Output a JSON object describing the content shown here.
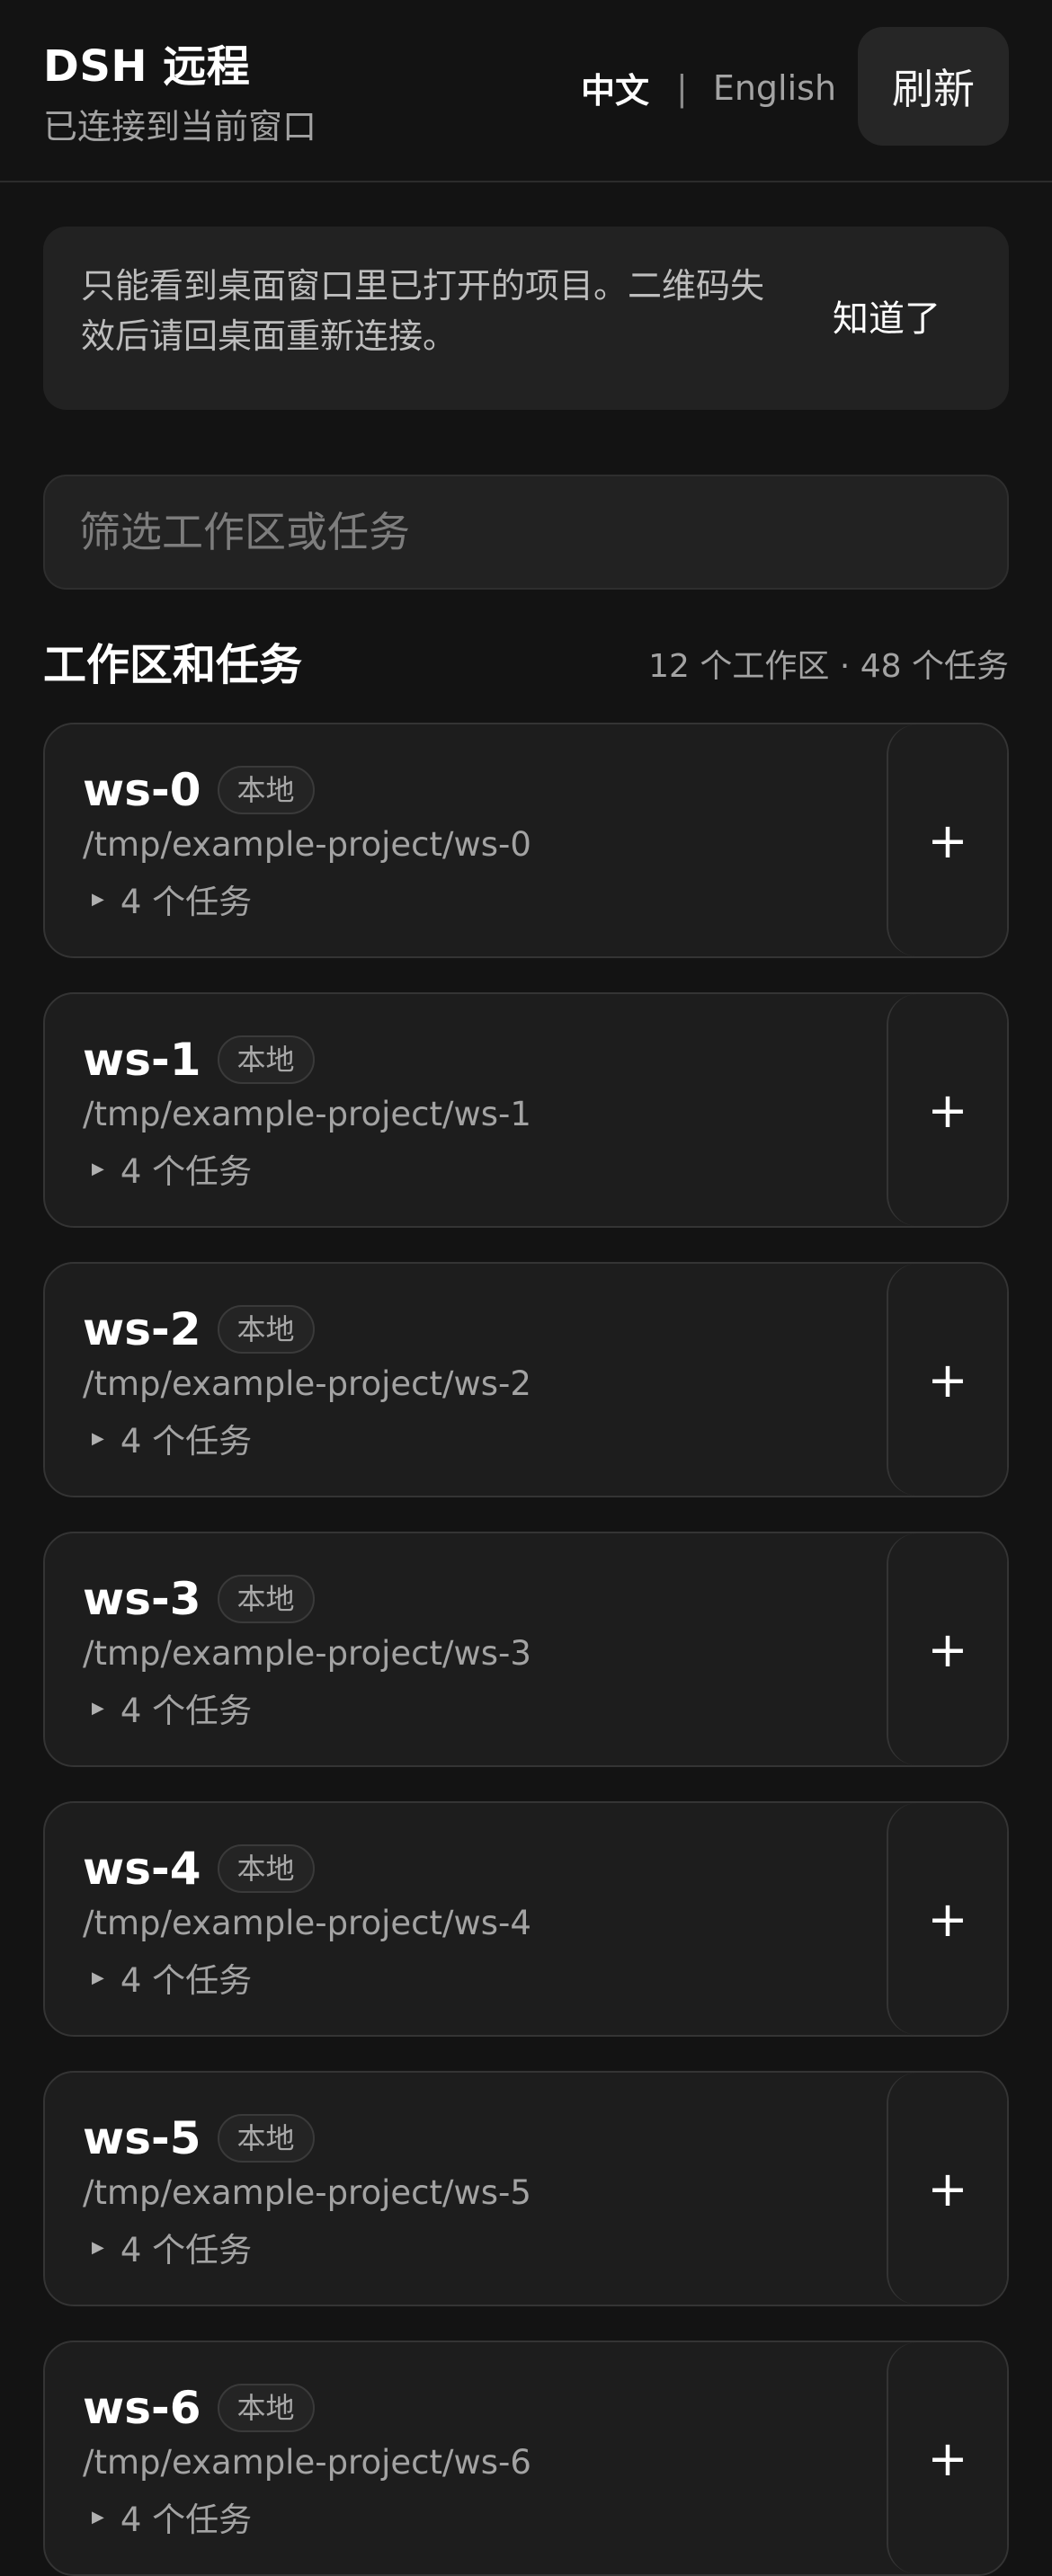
{
  "header": {
    "title": "DSH 远程",
    "status": "已连接到当前窗口",
    "lang_zh": "中文",
    "lang_sep": "|",
    "lang_en": "English",
    "refresh_label": "刷新"
  },
  "notice": {
    "text": "只能看到桌面窗口里已打开的项目。二维码失效后请回桌面重新连接。",
    "dismiss_label": "知道了"
  },
  "filter": {
    "placeholder": "筛选工作区或任务"
  },
  "section": {
    "title": "工作区和任务",
    "count": "12 个工作区 · 48 个任务"
  },
  "workspaces": [
    {
      "name": "ws-0",
      "badge": "本地",
      "path": "/tmp/example-project/ws-0",
      "tasks": "4 个任务",
      "add_label": "+"
    },
    {
      "name": "ws-1",
      "badge": "本地",
      "path": "/tmp/example-project/ws-1",
      "tasks": "4 个任务",
      "add_label": "+"
    },
    {
      "name": "ws-2",
      "badge": "本地",
      "path": "/tmp/example-project/ws-2",
      "tasks": "4 个任务",
      "add_label": "+"
    },
    {
      "name": "ws-3",
      "badge": "本地",
      "path": "/tmp/example-project/ws-3",
      "tasks": "4 个任务",
      "add_label": "+"
    },
    {
      "name": "ws-4",
      "badge": "本地",
      "path": "/tmp/example-project/ws-4",
      "tasks": "4 个任务",
      "add_label": "+"
    },
    {
      "name": "ws-5",
      "badge": "本地",
      "path": "/tmp/example-project/ws-5",
      "tasks": "4 个任务",
      "add_label": "+"
    },
    {
      "name": "ws-6",
      "badge": "本地",
      "path": "/tmp/example-project/ws-6",
      "tasks": "4 个任务",
      "add_label": "+"
    }
  ],
  "icons": {
    "expand": "triangle-right-icon"
  }
}
